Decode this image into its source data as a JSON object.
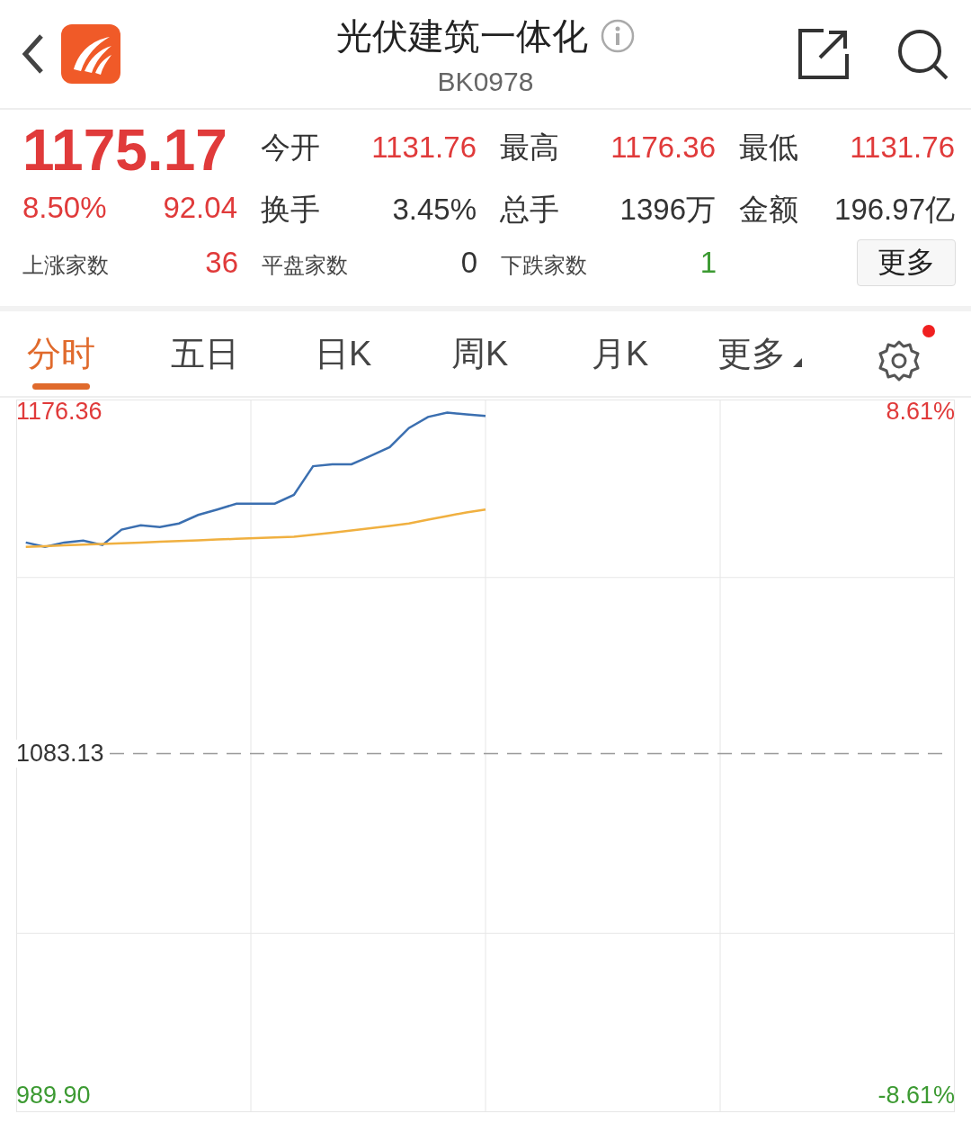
{
  "header": {
    "title": "光伏建筑一体化",
    "code": "BK0978"
  },
  "quote": {
    "price": "1175.17",
    "change_pct": "8.50%",
    "change": "92.04",
    "stats": [
      {
        "label": "今开",
        "value": "1131.76",
        "color": "#e03a3a"
      },
      {
        "label": "最高",
        "value": "1176.36",
        "color": "#e03a3a"
      },
      {
        "label": "最低",
        "value": "1131.76",
        "color": "#e03a3a"
      },
      {
        "label": "换手",
        "value": "3.45%",
        "color": "#333333"
      },
      {
        "label": "总手",
        "value": "1396万",
        "color": "#333333"
      },
      {
        "label": "金额",
        "value": "196.97亿",
        "color": "#333333"
      }
    ],
    "breadth": [
      {
        "label": "上涨家数",
        "value": "36",
        "color": "#e03a3a"
      },
      {
        "label": "平盘家数",
        "value": "0",
        "color": "#333333"
      },
      {
        "label": "下跌家数",
        "value": "1",
        "color": "#3c9a32"
      }
    ],
    "more_button": "更多"
  },
  "tabs": [
    {
      "label": "分时",
      "selected": true
    },
    {
      "label": "五日",
      "selected": false
    },
    {
      "label": "日K",
      "selected": false
    },
    {
      "label": "周K",
      "selected": false
    },
    {
      "label": "月K",
      "selected": false
    },
    {
      "label": "更多",
      "selected": false,
      "kind": "dropdown"
    }
  ],
  "settings": {
    "notification": true
  },
  "chart": {
    "right_labels": [
      {
        "label": "8.61%",
        "color": "#e03a3a"
      },
      {
        "label": "-8.61%",
        "color": "#3c9a32"
      }
    ],
    "chart_data": {
      "type": "line",
      "categories": [
        null,
        null,
        null,
        null,
        null,
        null,
        null,
        null,
        null,
        null,
        null,
        null,
        null,
        null,
        null,
        null,
        null,
        null,
        null,
        null,
        null,
        null,
        null,
        null,
        null,
        null,
        null,
        null,
        null,
        null,
        null,
        null,
        null,
        null,
        null,
        null,
        null,
        null,
        null,
        null,
        null,
        null,
        null,
        null,
        null,
        null,
        null,
        null,
        null
      ],
      "ylim": [
        985.65,
        1179.67
      ],
      "ref_lines": [
        {
          "axis": "y",
          "value": 1083.13
        }
      ],
      "yticks": [
        {
          "value": 1176.36,
          "label": "1176.36"
        },
        {
          "value": 1083.13,
          "label": "1083.13"
        },
        {
          "value": 989.9,
          "label": "989.90"
        }
      ],
      "series": [
        {
          "color": "#3b6fb0",
          "values": [
            1140.7,
            1139.5,
            1140.7,
            1141.2,
            1140.0,
            1144.2,
            1145.4,
            1144.9,
            1145.9,
            1148.2,
            1149.7,
            1151.3,
            1151.3,
            1151.3,
            1153.7,
            1161.5,
            1162.0,
            1162.0,
            1164.3,
            1166.7,
            1171.9,
            1174.9,
            1176.1,
            1175.6,
            1175.2,
            null,
            null,
            null,
            null,
            null,
            null,
            null,
            null,
            null,
            null,
            null,
            null,
            null,
            null,
            null,
            null,
            null,
            null,
            null,
            null,
            null,
            null,
            null,
            null
          ]
        },
        {
          "color": "#f0b040",
          "values": [
            1139.5,
            1139.7,
            1139.9,
            1140.1,
            1140.3,
            1140.5,
            1140.7,
            1140.9,
            1141.1,
            1141.3,
            1141.5,
            1141.7,
            1141.9,
            1142.1,
            1142.3,
            1142.8,
            1143.4,
            1144.0,
            1144.6,
            1145.2,
            1145.9,
            1146.9,
            1147.9,
            1148.9,
            1149.7,
            null,
            null,
            null,
            null,
            null,
            null,
            null,
            null,
            null,
            null,
            null,
            null,
            null,
            null,
            null,
            null,
            null,
            null,
            null,
            null,
            null,
            null,
            null,
            null
          ]
        }
      ]
    }
  }
}
